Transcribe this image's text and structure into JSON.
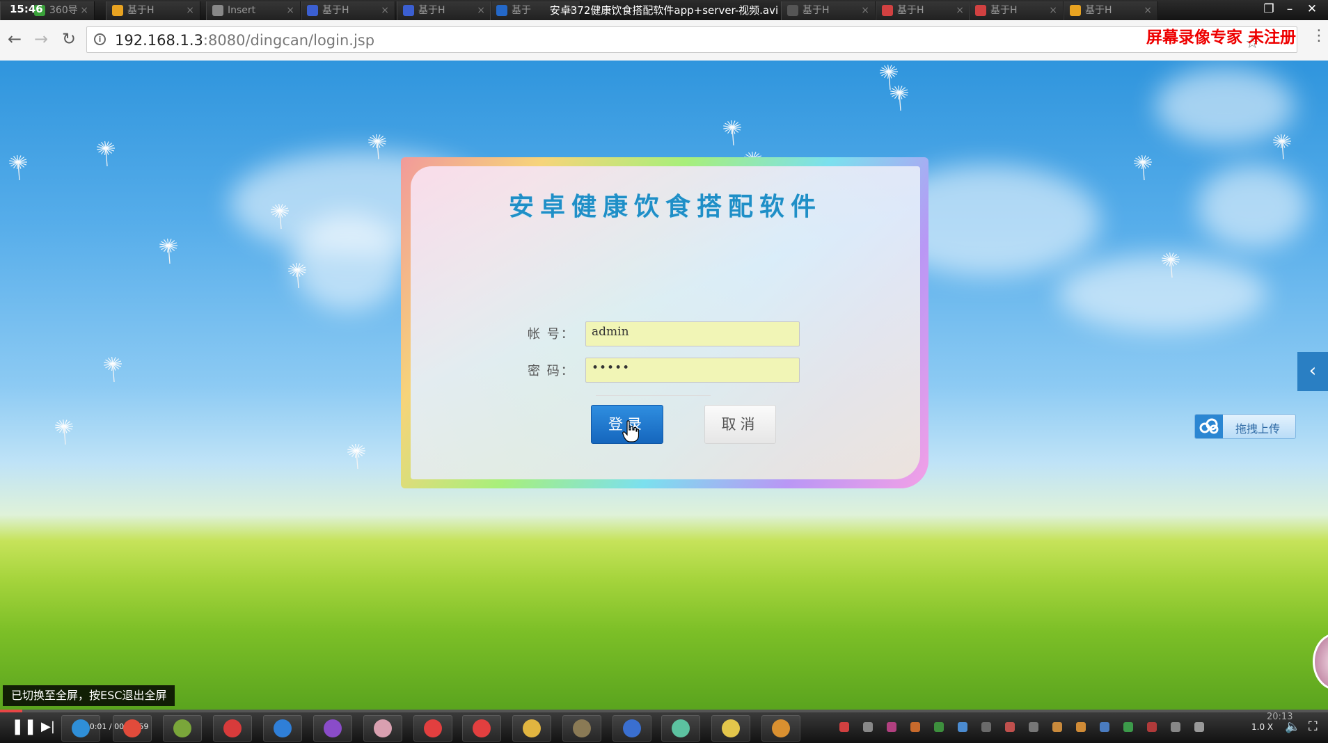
{
  "titlebar": {
    "clock": "15:46",
    "video_title": "安卓372健康饮食搭配软件app+server-视频.avi",
    "tabs": [
      {
        "label": "360导",
        "icon_color": "#3aa13a"
      },
      {
        "label": "基于H",
        "icon_color": "#e8a321"
      },
      {
        "label": "Insert",
        "icon_color": "#888888"
      },
      {
        "label": "基于H",
        "icon_color": "#3b5fd1"
      },
      {
        "label": "基于H",
        "icon_color": "#3b5fd1"
      },
      {
        "label": "基于",
        "icon_color": "#2468c8"
      },
      {
        "label": "基于H",
        "icon_color": "#555555"
      },
      {
        "label": "基于H",
        "icon_color": "#d14141"
      },
      {
        "label": "基于H",
        "icon_color": "#d14141"
      },
      {
        "label": "基于H",
        "icon_color": "#e8a321"
      }
    ]
  },
  "address_bar": {
    "url_host": "192.168.1.3",
    "url_rest": ":8080/dingcan/login.jsp",
    "watermark": "屏幕录像专家  未注册"
  },
  "login": {
    "title": "安卓健康饮食搭配软件",
    "account_label": "帐  号：",
    "account_value": "admin",
    "password_label": "密  码：",
    "password_value": "•••••",
    "login_button": "登录",
    "cancel_button": "取消"
  },
  "sidebar": {
    "collapse_arrow": "‹",
    "upload_label": "拖拽上传"
  },
  "toast": {
    "text": "已切换至全屏，按ESC退出全屏"
  },
  "player": {
    "time": "00:00:01 / 00:00:59",
    "progress": 0.017,
    "speed": "1.0 X",
    "clock": "20:13"
  },
  "colors": {
    "title_blue": "#1f8fc7",
    "login_blue": "#1f78d1",
    "input_yellow": "#f1f5b6",
    "watermark_red": "#ee0000"
  },
  "icons": {
    "back": "back-arrow-icon",
    "forward": "forward-arrow-icon",
    "reload": "reload-icon",
    "info": "info-icon",
    "bookmark": "star-icon",
    "menu": "menu-dots-icon",
    "upload": "cloud-upload-icon"
  }
}
